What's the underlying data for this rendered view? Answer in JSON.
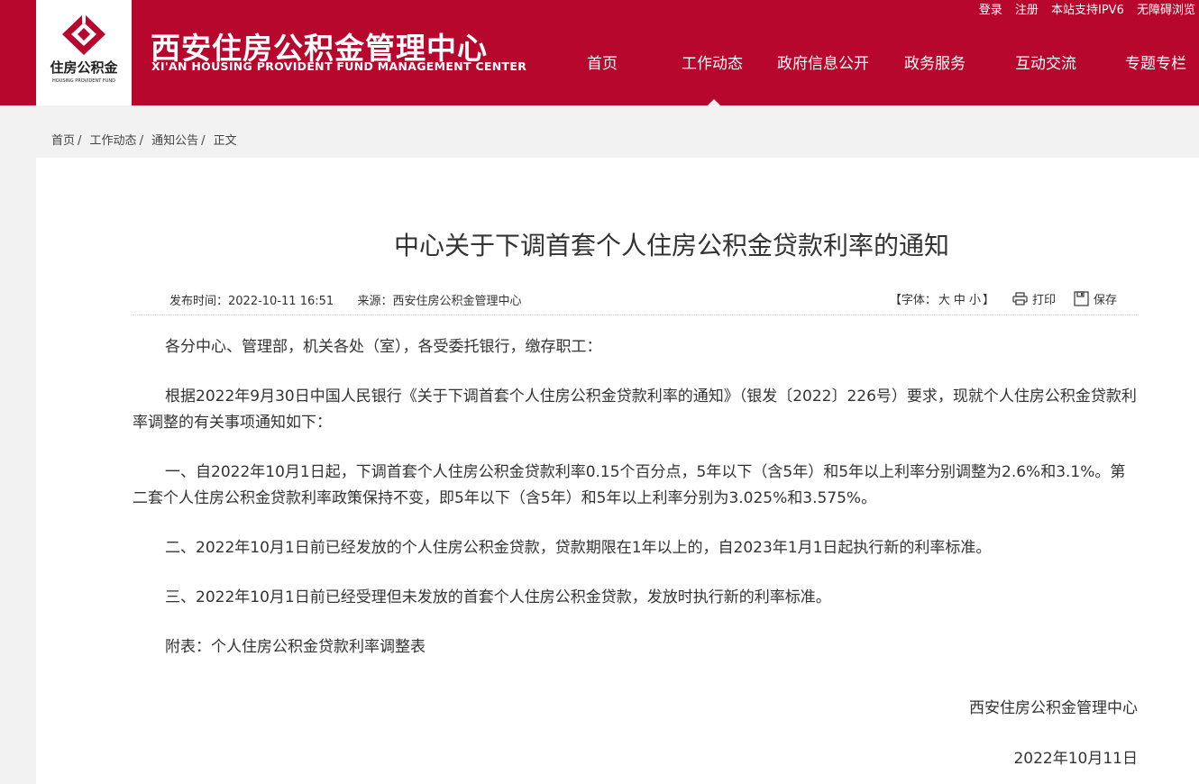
{
  "header": {
    "logo_text": "住房公积金",
    "logo_subtext": "HOUSING PROVIDENT FUND",
    "site_title": "西安住房公积金管理中心",
    "site_subtitle": "XI'AN HOUSING PROVIDENT FUND MANAGEMENT CENTER",
    "top_links": [
      "登录",
      "注册",
      "本站支持IPV6",
      "无障碍浏览"
    ],
    "nav": [
      "首页",
      "工作动态",
      "政府信息公开",
      "政务服务",
      "互动交流",
      "专题专栏"
    ],
    "colors": {
      "brand": "#b8072d",
      "page_bg": "#f2f2f2"
    }
  },
  "breadcrumb": [
    "首页",
    "工作动态",
    "通知公告",
    "正文"
  ],
  "breadcrumb_sep": "/",
  "article": {
    "title": "中心关于下调首套个人住房公积金贷款利率的通知",
    "publish_label": "发布时间：",
    "publish_time": "2022-10-11 16:51",
    "source_label": "来源：",
    "source": "西安住房公积金管理中心",
    "font_open": "【字体：",
    "font_sizes": [
      "大",
      "中",
      "小"
    ],
    "font_close": "】",
    "print_label": "打印",
    "save_label": "保存",
    "paragraphs": [
      "各分中心、管理部，机关各处（室），各受委托银行，缴存职工：",
      "根据2022年9月30日中国人民银行《关于下调首套个人住房公积金贷款利率的通知》（银发〔2022〕226号）要求，现就个人住房公积金贷款利率调整的有关事项通知如下：",
      "一、自2022年10月1日起，下调首套个人住房公积金贷款利率0.15个百分点，5年以下（含5年）和5年以上利率分别调整为2.6%和3.1%。第二套个人住房公积金贷款利率政策保持不变，即5年以下（含5年）和5年以上利率分别为3.025%和3.575%。",
      "二、2022年10月1日前已经发放的个人住房公积金贷款，贷款期限在1年以上的，自2023年1月1日起执行新的利率标准。",
      "三、2022年10月1日前已经受理但未发放的首套个人住房公积金贷款，发放时执行新的利率标准。",
      "附表：个人住房公积金贷款利率调整表"
    ],
    "signature": "西安住房公积金管理中心",
    "date": "2022年10月11日"
  }
}
